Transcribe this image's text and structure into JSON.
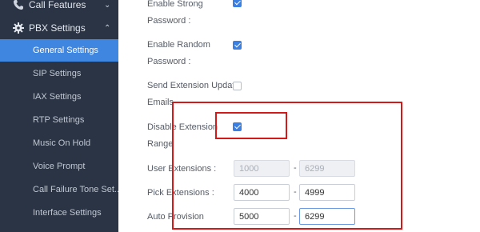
{
  "sidebar": {
    "call_features": {
      "label": "Call Features",
      "icon": "phone-icon"
    },
    "pbx_settings": {
      "label": "PBX Settings",
      "icon": "gear-icon",
      "expanded": true
    },
    "items": [
      {
        "label": "General Settings",
        "active": true
      },
      {
        "label": "SIP Settings"
      },
      {
        "label": "IAX Settings"
      },
      {
        "label": "RTP Settings"
      },
      {
        "label": "Music On Hold"
      },
      {
        "label": "Voice Prompt"
      },
      {
        "label": "Call Failure Tone Set..."
      },
      {
        "label": "Interface Settings"
      }
    ],
    "colors": {
      "background": "#2a3444",
      "active": "#3e86df"
    }
  },
  "form": {
    "enable_strong_password": {
      "line1": "Enable Strong",
      "line2": "Password :",
      "checked": true
    },
    "enable_random_password": {
      "line1": "Enable Random",
      "line2": "Password :",
      "checked": true
    },
    "send_extension_update": {
      "line1": "Send Extension Update",
      "line2": "Emails",
      "checked": false
    },
    "disable_extension_range": {
      "line1": "Disable Extension",
      "line2": "Range",
      "checked": true
    },
    "user_extensions": {
      "label": "User Extensions :",
      "start": "1000",
      "end": "6299",
      "disabled": true
    },
    "pick_extensions": {
      "label": "Pick Extensions :",
      "start": "4000",
      "end": "4999"
    },
    "auto_provision": {
      "label": "Auto Provision",
      "start": "5000",
      "end": "6299"
    },
    "range_separator": "-"
  },
  "highlight_color": "#d21a1a"
}
